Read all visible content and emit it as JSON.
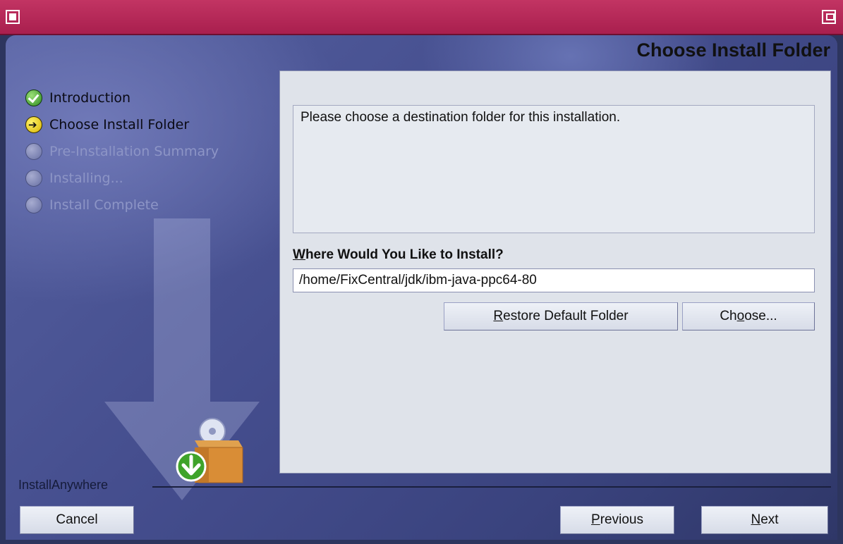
{
  "titlebar": {
    "left_icon": "window-menu-icon",
    "right_icon": "maximize-icon"
  },
  "header": {
    "title": "Choose Install Folder"
  },
  "steps": [
    {
      "label": "Introduction",
      "state": "done"
    },
    {
      "label": "Choose Install Folder",
      "state": "current"
    },
    {
      "label": "Pre-Installation Summary",
      "state": "pending"
    },
    {
      "label": "Installing...",
      "state": "pending"
    },
    {
      "label": "Install Complete",
      "state": "pending"
    }
  ],
  "main": {
    "description": "Please choose a destination folder for this installation.",
    "where_label_mnemonic": "W",
    "where_label_rest": "here Would You Like to Install?",
    "path_value": "/home/FixCentral/jdk/ibm-java-ppc64-80",
    "restore_pre": "",
    "restore_mnemonic": "R",
    "restore_post": "estore Default Folder",
    "choose_pre": "Ch",
    "choose_mnemonic": "o",
    "choose_post": "ose..."
  },
  "footer": {
    "brand": "InstallAnywhere",
    "cancel_label": "Cancel",
    "previous_mnemonic": "P",
    "previous_rest": "revious",
    "next_mnemonic": "N",
    "next_rest": "ext"
  },
  "colors": {
    "titlebar": "#b82858",
    "panel": "#dfe3ea",
    "background": "#444d8d"
  }
}
